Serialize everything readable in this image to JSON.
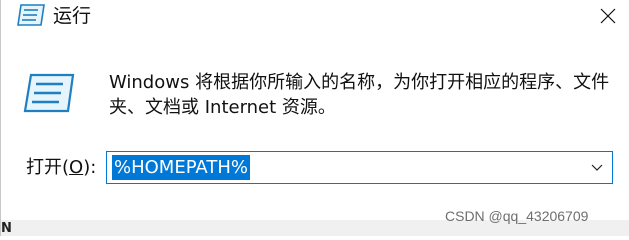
{
  "window": {
    "title": "运行",
    "close_icon": "close-icon",
    "run_icon": "run-dialog-icon"
  },
  "body": {
    "description": "Windows 将根据你所输入的名称，为你打开相应的程序、文件夹、文档或 Internet 资源。"
  },
  "open_field": {
    "label_prefix": "打开(",
    "label_mnemonic": "O",
    "label_suffix": "):",
    "value": "%HOMEPATH%",
    "dropdown_icon": "chevron-down-icon"
  },
  "watermark": "CSDN @qq_43206709",
  "cut_glyph": "N",
  "colors": {
    "accent": "#0078d7",
    "footer": "#f0f0f0",
    "text": "#111111"
  }
}
